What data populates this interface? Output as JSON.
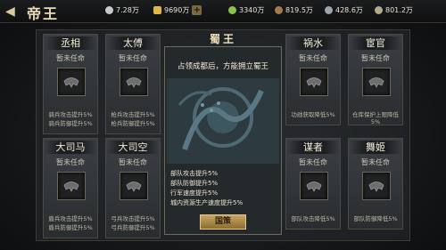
{
  "header": {
    "title": "帝王",
    "resources": [
      {
        "icon": "silver-coin-icon",
        "value": "7.28万",
        "color": "#c9c9c9"
      },
      {
        "icon": "gold-ingot-icon",
        "value": "9690万",
        "color": "#e0b84a"
      },
      {
        "icon": "grain-icon",
        "value": "3340万",
        "color": "#8bc34a"
      },
      {
        "icon": "wood-icon",
        "value": "819.5万",
        "color": "#a57a4b"
      },
      {
        "icon": "iron-icon",
        "value": "428.6万",
        "color": "#9aa7b0"
      },
      {
        "icon": "stone-icon",
        "value": "801.2万",
        "color": "#b3aa8e"
      }
    ]
  },
  "center": {
    "title": "蜀王",
    "description": "占领成都后，方能拥立蜀王",
    "bonuses": [
      "部队攻击提升5%",
      "部队防御提升5%",
      "行军速度提升5%",
      "城内资源生产速度提升5%"
    ],
    "button": "国策"
  },
  "officials": [
    {
      "name": "丞相",
      "status": "暂未任命",
      "bonus1": "骑兵攻击提升5%",
      "bonus2": "骑兵防御提升5%"
    },
    {
      "name": "太傅",
      "status": "暂未任命",
      "bonus1": "枪兵攻击提升5%",
      "bonus2": "枪兵防御提升5%"
    },
    {
      "name": "大司马",
      "status": "暂未任命",
      "bonus1": "盾兵攻击提升5%",
      "bonus2": "盾兵防御提升5%"
    },
    {
      "name": "大司空",
      "status": "暂未任命",
      "bonus1": "弓兵攻击提升5%",
      "bonus2": "弓兵防御提升5%"
    },
    {
      "name": "祸水",
      "status": "暂未任命",
      "bonus1": "功勋获取降低5%",
      "bonus2": ""
    },
    {
      "name": "宦官",
      "status": "暂未任命",
      "bonus1": "仓库保护上限降低5%",
      "bonus2": ""
    },
    {
      "name": "谋者",
      "status": "暂未任命",
      "bonus1": "部队攻击降低5%",
      "bonus2": ""
    },
    {
      "name": "舞姬",
      "status": "暂未任命",
      "bonus1": "部队防御降低5%",
      "bonus2": ""
    }
  ]
}
